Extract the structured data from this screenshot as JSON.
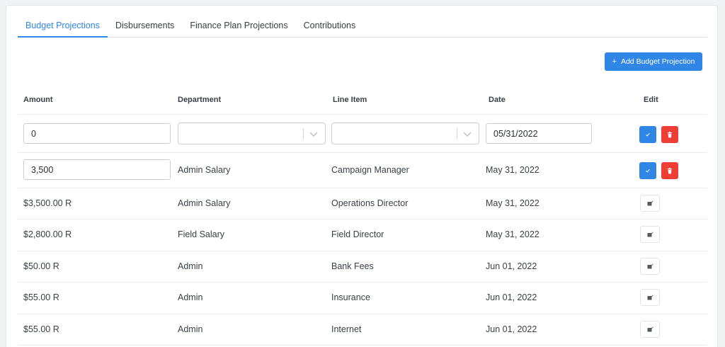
{
  "tabs": [
    {
      "label": "Budget Projections",
      "active": true
    },
    {
      "label": "Disbursements",
      "active": false
    },
    {
      "label": "Finance Plan Projections",
      "active": false
    },
    {
      "label": "Contributions",
      "active": false
    }
  ],
  "add_button": {
    "label": "Add Budget Projection"
  },
  "columns": {
    "amount": "Amount",
    "department": "Department",
    "line_item": "Line Item",
    "date": "Date",
    "edit": "Edit"
  },
  "new_row": {
    "amount": "0",
    "department": "",
    "line_item": "",
    "date": "05/31/2022"
  },
  "editing_row": {
    "amount": "3,500",
    "department": "Admin Salary",
    "line_item": "Campaign Manager",
    "date": "May 31, 2022"
  },
  "rows": [
    {
      "amount": "$3,500.00 R",
      "department": "Admin Salary",
      "line_item": "Operations Director",
      "date": "May 31, 2022"
    },
    {
      "amount": "$2,800.00 R",
      "department": "Field Salary",
      "line_item": "Field Director",
      "date": "May 31, 2022"
    },
    {
      "amount": "$50.00 R",
      "department": "Admin",
      "line_item": "Bank Fees",
      "date": "Jun 01, 2022"
    },
    {
      "amount": "$55.00 R",
      "department": "Admin",
      "line_item": "Insurance",
      "date": "Jun 01, 2022"
    },
    {
      "amount": "$55.00 R",
      "department": "Admin",
      "line_item": "Internet",
      "date": "Jun 01, 2022"
    }
  ],
  "colors": {
    "primary": "#2f86e6",
    "danger": "#ef3e36"
  },
  "icons": {
    "add": "plus-icon",
    "confirm": "check-icon",
    "delete": "trash-icon",
    "edit": "edit-icon",
    "dropdown": "chevron-down-icon"
  }
}
